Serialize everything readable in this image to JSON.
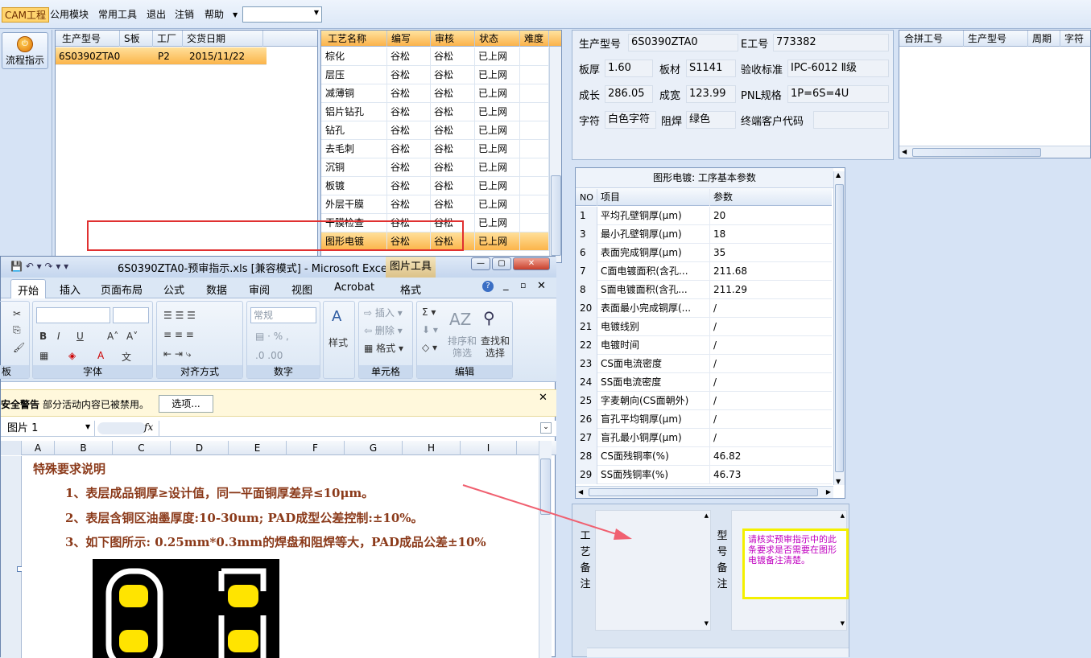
{
  "menubar": {
    "items": [
      "CAM工程",
      "公用模块",
      "常用工具",
      "退出",
      "注销",
      "帮助"
    ],
    "combo_value": ""
  },
  "left_toolbar": {
    "flow_label": "流程指示"
  },
  "orders": {
    "headers": [
      "生产型号",
      "S板",
      "工厂",
      "交货日期"
    ],
    "rows": [
      [
        "6S0390ZTA0",
        "",
        "P2",
        "2015/11/22"
      ]
    ]
  },
  "process": {
    "headers": [
      "工艺名称",
      "编写",
      "审核",
      "状态",
      "难度"
    ],
    "rows": [
      [
        "棕化",
        "谷松",
        "谷松",
        "已上网",
        ""
      ],
      [
        "层压",
        "谷松",
        "谷松",
        "已上网",
        ""
      ],
      [
        "减薄铜",
        "谷松",
        "谷松",
        "已上网",
        ""
      ],
      [
        "铝片钻孔",
        "谷松",
        "谷松",
        "已上网",
        ""
      ],
      [
        "钻孔",
        "谷松",
        "谷松",
        "已上网",
        ""
      ],
      [
        "去毛刺",
        "谷松",
        "谷松",
        "已上网",
        ""
      ],
      [
        "沉铜",
        "谷松",
        "谷松",
        "已上网",
        ""
      ],
      [
        "板镀",
        "谷松",
        "谷松",
        "已上网",
        ""
      ],
      [
        "外层干膜",
        "谷松",
        "谷松",
        "已上网",
        ""
      ],
      [
        "干膜检查",
        "谷松",
        "谷松",
        "已上网",
        ""
      ],
      [
        "图形电镀",
        "谷松",
        "谷松",
        "已上网",
        ""
      ]
    ],
    "selected_index": 10
  },
  "info": {
    "model_label": "生产型号",
    "model": "6S0390ZTA0",
    "e_label": "E工号",
    "e_no": "773382",
    "thick_label": "板厚",
    "thick": "1.60",
    "mat_label": "板材",
    "mat": "S1141",
    "std_label": "验收标准",
    "std": "IPC-6012 Ⅱ级",
    "len_label": "成长",
    "len": "286.05",
    "wid_label": "成宽",
    "wid": "123.99",
    "pnl_label": "PNL规格",
    "pnl": "1P=6S=4U",
    "char_label": "字符",
    "char": "白色字符",
    "mask_label": "阻焊",
    "mask": "绿色",
    "cust_label": "终端客户代码",
    "cust": ""
  },
  "combine": {
    "headers": [
      "合拼工号",
      "生产型号",
      "周期",
      "字符"
    ]
  },
  "params": {
    "title": "图形电镀: 工序基本参数",
    "headers": [
      "NO",
      "项目",
      "参数"
    ],
    "rows": [
      [
        "1",
        "平均孔壁铜厚(μm)",
        "20"
      ],
      [
        "3",
        "最小孔壁铜厚(μm)",
        "18"
      ],
      [
        "6",
        "表面完成铜厚(μm)",
        "35"
      ],
      [
        "7",
        "C面电镀面积(含孔...",
        "211.68"
      ],
      [
        "8",
        "S面电镀面积(含孔...",
        "211.29"
      ],
      [
        "20",
        "表面最小完成铜厚(...",
        "/"
      ],
      [
        "21",
        "电镀线别",
        "/"
      ],
      [
        "22",
        "电镀时间",
        "/"
      ],
      [
        "23",
        "CS面电流密度",
        "/"
      ],
      [
        "24",
        "SS面电流密度",
        "/"
      ],
      [
        "25",
        "字麦朝向(CS面朝外)",
        "/"
      ],
      [
        "26",
        "盲孔平均铜厚(μm)",
        "/"
      ],
      [
        "27",
        "盲孔最小铜厚(μm)",
        "/"
      ],
      [
        "28",
        "CS面残铜率(%)",
        "46.82"
      ],
      [
        "29",
        "SS面残铜率(%)",
        "46.73"
      ]
    ]
  },
  "remarks": {
    "process_label": "工艺备注",
    "model_label": "型号备注",
    "model_note": "请核实预审指示中的此条要求是否需要在图形电镀备注清楚。"
  },
  "excel": {
    "title": "6S0390ZTA0-预审指示.xls [兼容模式] - Microsoft Excel",
    "picture_tools": "图片工具",
    "tabs": [
      "开始",
      "插入",
      "页面布局",
      "公式",
      "数据",
      "审阅",
      "视图",
      "Acrobat",
      "格式"
    ],
    "groups": [
      "板",
      "字体",
      "对齐方式",
      "数字",
      "单元格",
      "编辑"
    ],
    "number_format": "常规",
    "styles_label": "样式",
    "cell_insert": "插入",
    "cell_delete": "删除",
    "cell_format": "格式",
    "sort_label": "排序和筛选",
    "find_label": "查找和选择",
    "security_label": "安全警告",
    "security_text": "部分活动内容已被禁用。",
    "options_btn": "选项...",
    "name_box": "图片 1",
    "fx": "fx",
    "columns": [
      "A",
      "B",
      "C",
      "D",
      "E",
      "F",
      "G",
      "H",
      "I"
    ],
    "lines": [
      "特殊要求说明",
      "1、表层成品铜厚≥设计值，同一平面铜厚差异≤10μm。",
      "2、表层含铜区油墨厚度:10-30um; PAD成型公差控制:±10%。",
      "3、如下图所示: 0.25mm*0.3mm的焊盘和阻焊等大，PAD成品公差±10%"
    ]
  }
}
